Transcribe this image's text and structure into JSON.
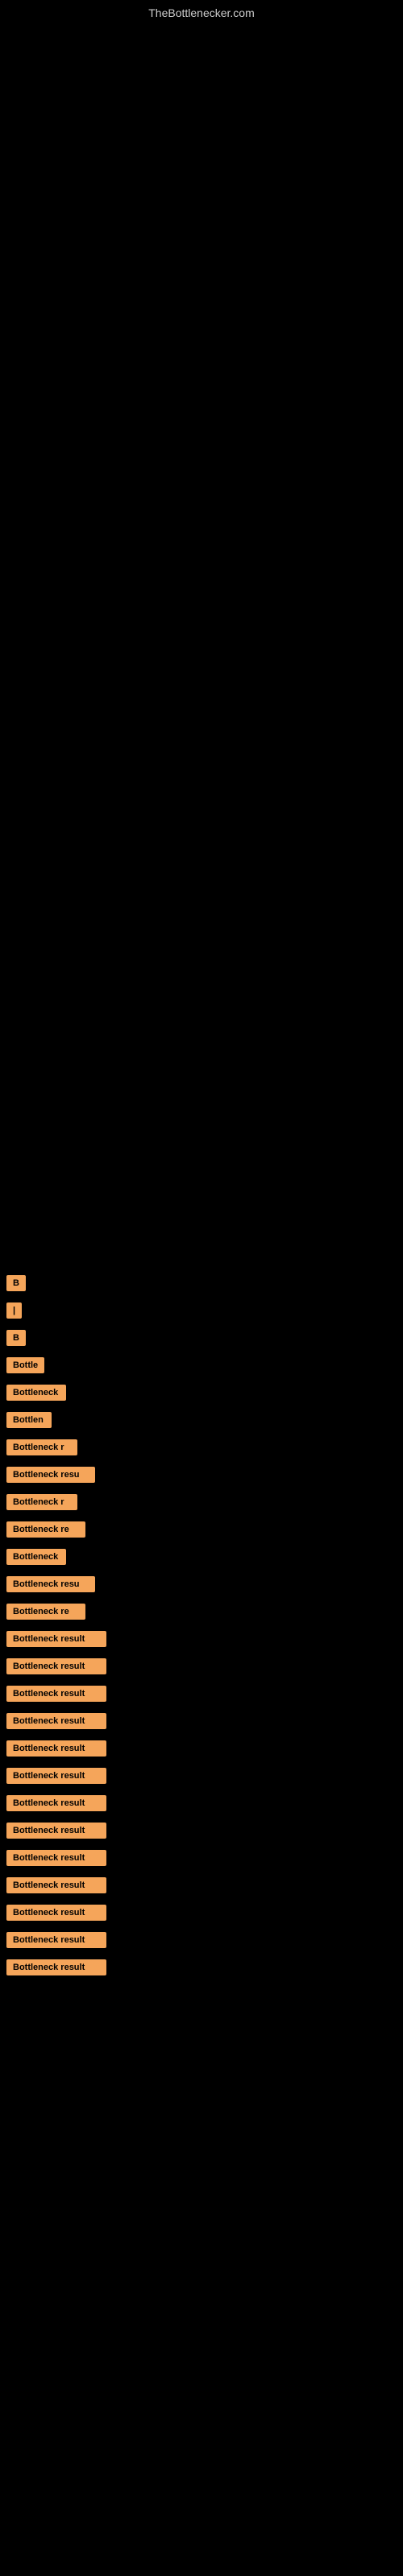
{
  "site": {
    "title": "TheBottlenecker.com"
  },
  "badges": [
    {
      "id": 1,
      "label": "B",
      "width": 18
    },
    {
      "id": 2,
      "label": "|",
      "width": 12
    },
    {
      "id": 3,
      "label": "B",
      "width": 18
    },
    {
      "id": 4,
      "label": "Bottle",
      "width": 42
    },
    {
      "id": 5,
      "label": "Bottleneck",
      "width": 74
    },
    {
      "id": 6,
      "label": "Bottlen",
      "width": 56
    },
    {
      "id": 7,
      "label": "Bottleneck r",
      "width": 88
    },
    {
      "id": 8,
      "label": "Bottleneck resu",
      "width": 110
    },
    {
      "id": 9,
      "label": "Bottleneck r",
      "width": 88
    },
    {
      "id": 10,
      "label": "Bottleneck re",
      "width": 98
    },
    {
      "id": 11,
      "label": "Bottleneck",
      "width": 74
    },
    {
      "id": 12,
      "label": "Bottleneck resu",
      "width": 110
    },
    {
      "id": 13,
      "label": "Bottleneck re",
      "width": 98
    },
    {
      "id": 14,
      "label": "Bottleneck result",
      "width": 124
    },
    {
      "id": 15,
      "label": "Bottleneck result",
      "width": 124
    },
    {
      "id": 16,
      "label": "Bottleneck result",
      "width": 124
    },
    {
      "id": 17,
      "label": "Bottleneck result",
      "width": 124
    },
    {
      "id": 18,
      "label": "Bottleneck result",
      "width": 124
    },
    {
      "id": 19,
      "label": "Bottleneck result",
      "width": 124
    },
    {
      "id": 20,
      "label": "Bottleneck result",
      "width": 124
    },
    {
      "id": 21,
      "label": "Bottleneck result",
      "width": 124
    },
    {
      "id": 22,
      "label": "Bottleneck result",
      "width": 124
    },
    {
      "id": 23,
      "label": "Bottleneck result",
      "width": 124
    },
    {
      "id": 24,
      "label": "Bottleneck result",
      "width": 124
    },
    {
      "id": 25,
      "label": "Bottleneck result",
      "width": 124
    },
    {
      "id": 26,
      "label": "Bottleneck result",
      "width": 124
    }
  ]
}
